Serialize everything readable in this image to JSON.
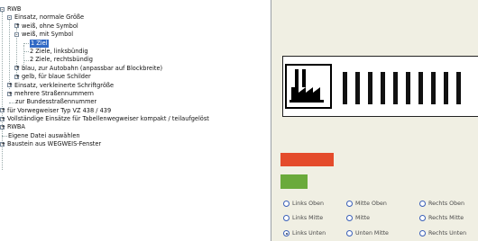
{
  "tree": {
    "nodes": [
      {
        "label": "RWB",
        "toggle": "-"
      },
      {
        "label": "Einsatz, normale Größe",
        "toggle": "-"
      },
      {
        "label": "weiß, ohne Symbol",
        "toggle": "+"
      },
      {
        "label": "weiß, mit Symbol",
        "toggle": "-"
      },
      {
        "label": "1 Ziel",
        "toggle": "",
        "selected": true
      },
      {
        "label": "2 Ziele, linksbündig",
        "toggle": ""
      },
      {
        "label": "2 Ziele, rechtsbündig",
        "toggle": ""
      },
      {
        "label": "blau, zur Autobahn (anpassbar auf Blockbreite)",
        "toggle": "+"
      },
      {
        "label": "gelb, für blaue Schilder",
        "toggle": "+"
      },
      {
        "label": "Einsatz, verkleinerte Schriftgröße",
        "toggle": "+"
      },
      {
        "label": "mehrere Straßennummern",
        "toggle": "+"
      },
      {
        "label": "zur Bundesstraßennummer",
        "toggle": ""
      },
      {
        "label": "für Vorwegweiser Typ VZ 438 / 439",
        "toggle": "+"
      },
      {
        "label": "Vollständige Einsätze für Tabellenwegweiser kompakt / teilaufgelöst",
        "toggle": "+"
      },
      {
        "label": "RWBA",
        "toggle": "+"
      },
      {
        "label": "Eigene Datei auswählen",
        "toggle": ""
      },
      {
        "label": "Baustein aus WEGWEIS-Fenster",
        "toggle": "+"
      }
    ]
  },
  "preview": {
    "symbol_icon": "factory-icon",
    "bar_count": 10,
    "colors": {
      "red": "#e44b2b",
      "green": "#6aaa3b"
    }
  },
  "alignment": {
    "options": [
      {
        "label": "Links Oben",
        "checked": false
      },
      {
        "label": "Mitte Oben",
        "checked": false
      },
      {
        "label": "Rechts Oben",
        "checked": false
      },
      {
        "label": "Links Mitte",
        "checked": false
      },
      {
        "label": "Mitte",
        "checked": false
      },
      {
        "label": "Rechts Mitte",
        "checked": false
      },
      {
        "label": "Links Unten",
        "checked": true
      },
      {
        "label": "Unten Mitte",
        "checked": false
      },
      {
        "label": "Rechts Unten",
        "checked": false
      }
    ]
  }
}
